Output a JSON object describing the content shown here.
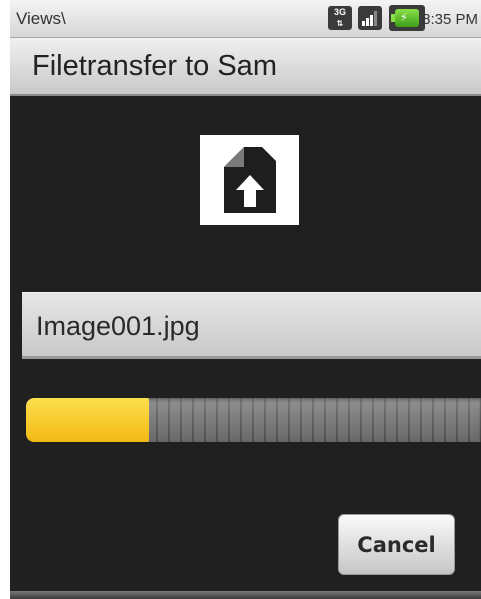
{
  "status_bar": {
    "title": "Views\\",
    "network_badge": "3G",
    "time": "8:35 PM",
    "icons": [
      "3g-data-icon",
      "signal-strength-icon",
      "battery-charging-icon"
    ],
    "battery_color": "#5cc22a"
  },
  "dialog": {
    "title": "Filetransfer to Sam",
    "file_icon": "file-upload-icon",
    "file_name": "Image001.jpg",
    "progress": 0.27,
    "progress_color": "#f8cc22",
    "cancel_label": "Cancel"
  }
}
